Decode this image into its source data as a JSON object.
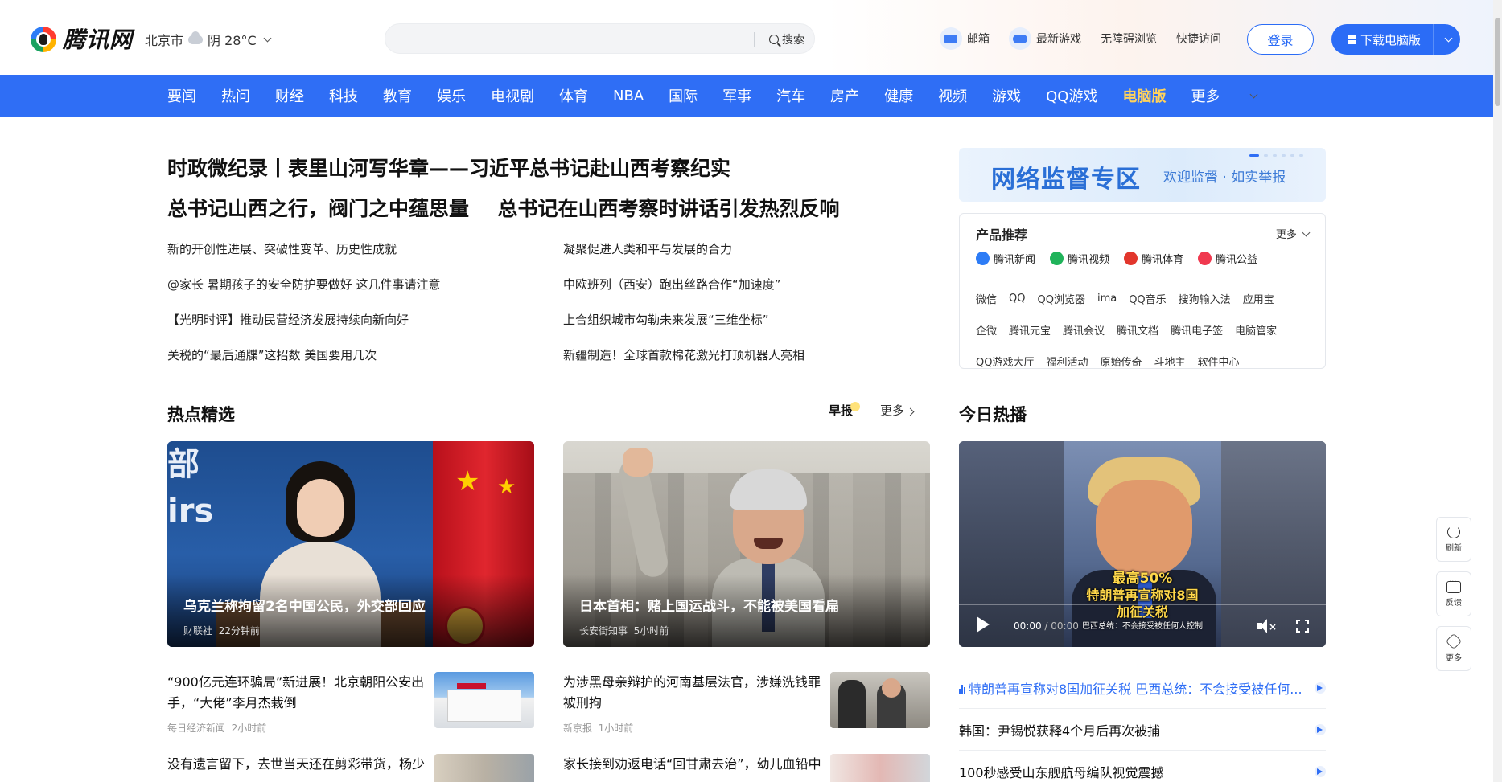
{
  "header": {
    "logo_text": "腾讯网",
    "city": "北京市",
    "weather": "阴 28°C",
    "search_label": "搜索",
    "links": [
      {
        "label": "邮箱",
        "icon": "mail-icon"
      },
      {
        "label": "最新游戏",
        "icon": "gamepad-icon"
      },
      {
        "label": "无障碍浏览"
      },
      {
        "label": "快捷访问"
      }
    ],
    "login_label": "登录",
    "download_label": "下载电脑版"
  },
  "nav": {
    "items": [
      "要闻",
      "热问",
      "财经",
      "科技",
      "教育",
      "娱乐",
      "电视剧",
      "体育",
      "NBA",
      "国际",
      "军事",
      "汽车",
      "房产",
      "健康",
      "视频",
      "游戏",
      "QQ游戏",
      "电脑版",
      "更多"
    ]
  },
  "headlines": {
    "main": "时政微纪录丨表里山河写华章——习近平总书记赴山西考察纪实",
    "second_a": "总书记山西之行，阀门之中蕴思量",
    "second_b": "总书记在山西考察时讲话引发热烈反响",
    "list": [
      "新的开创性进展、突破性变革、历史性成就",
      "凝聚促进人类和平与发展的合力",
      "@家长 暑期孩子的安全防护要做好 这几件事请注意",
      "中欧班列（西安）跑出丝路合作“加速度”",
      "【光明时评】推动民营经济发展持续向新向好",
      "上合组织城市勾勒未来发展“三维坐标”",
      "关税的“最后通牒”这招数 美国要用几次",
      "新疆制造！全球首款棉花激光打顶机器人亮相"
    ]
  },
  "banner": {
    "title": "网络监督专区",
    "subtitle": "欢迎监督 · 如实举报"
  },
  "products": {
    "title": "产品推荐",
    "more": "更多",
    "apps": [
      {
        "label": "腾讯新闻",
        "color": "#2d7cf6"
      },
      {
        "label": "腾讯视频",
        "color": "#20b35a"
      },
      {
        "label": "腾讯体育",
        "color": "#e2362c"
      },
      {
        "label": "腾讯公益",
        "color": "#f0394f"
      }
    ],
    "rows": [
      [
        "微信",
        "QQ",
        "QQ浏览器",
        "ima",
        "QQ音乐",
        "搜狗输入法",
        "应用宝"
      ],
      [
        "企微",
        "腾讯元宝",
        "腾讯会议",
        "腾讯文档",
        "腾讯电子签",
        "电脑管家"
      ],
      [
        "QQ游戏大厅",
        "福利活动",
        "原始传奇",
        "斗地主",
        "软件中心"
      ]
    ]
  },
  "sections": {
    "hot_title": "热点精选",
    "zaobao": "早报",
    "more": "更多",
    "today_title": "今日热播"
  },
  "cards": [
    {
      "title": "乌克兰称拘留2名中国公民，外交部回应",
      "source": "财联社",
      "time": "22分钟前",
      "bg_text": "部",
      "bg_text2": "irs"
    },
    {
      "title": "日本首相：赌上国运战斗，不能被美国看扁",
      "source": "长安街知事",
      "time": "5小时前"
    }
  ],
  "video": {
    "caption1": "最高50%",
    "caption2": "特朗普再宣称对8国",
    "caption3": "加征关税",
    "subtitle": "巴西总统：不会接受被任何人控制",
    "time_current": "00:00",
    "time_total": "00:00"
  },
  "feed": [
    {
      "title": "“900亿元连环骗局”新进展！北京朝阳公安出手，“大佬”李月杰栽倒",
      "source": "每日经济新闻",
      "time": "2小时前"
    },
    {
      "title": "为涉黑母亲辩护的河南基层法官，涉嫌洗钱罪被刑拘",
      "source": "新京报",
      "time": "1小时前"
    },
    {
      "title": "没有遗言留下，去世当天还在剪彩带货，杨少",
      "source": "",
      "time": ""
    },
    {
      "title": "家长接到劝返电话“回甘肃去治”，幼儿血铅中",
      "source": "",
      "time": ""
    }
  ],
  "hot_list": [
    "特朗普再宣称对8国加征关税 巴西总统：不会接受被任何...",
    "韩国：尹锡悦获释4个月后再次被捕",
    "100秒感受山东舰航母编队视觉震撼"
  ],
  "float_tools": [
    "刷新",
    "反馈",
    "更多"
  ]
}
